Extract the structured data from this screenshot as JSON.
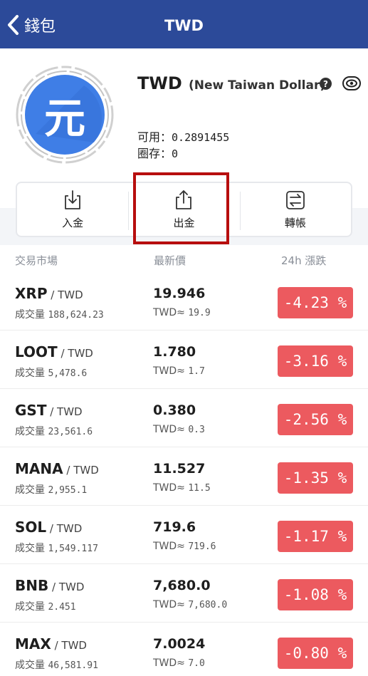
{
  "header": {
    "back_label": "錢包",
    "title": "TWD"
  },
  "currency": {
    "code": "TWD",
    "name": "(New Taiwan Dollar)",
    "icon_glyph": "元",
    "icon_color": "#3f7ee6",
    "available_label": "可用：",
    "available_value": "0.2891455",
    "locked_label": "圈存：",
    "locked_value": "0",
    "help_icon": "question-circle-icon",
    "visibility_icon": "eye-icon"
  },
  "actions": [
    {
      "label": "入金",
      "icon": "download-icon"
    },
    {
      "label": "出金",
      "icon": "upload-icon"
    },
    {
      "label": "轉帳",
      "icon": "transfer-icon"
    }
  ],
  "table": {
    "headers": [
      "交易市場",
      "最新價",
      "24h 漲跌"
    ],
    "vol_label": "成交量",
    "approx_prefix": "TWD≈",
    "rows": [
      {
        "symbol": "XRP",
        "quote": " / TWD",
        "volume": "188,624.23",
        "price": "19.946",
        "approx": "19.9",
        "change": "-4.23 %"
      },
      {
        "symbol": "LOOT",
        "quote": " / TWD",
        "volume": "5,478.6",
        "price": "1.780",
        "approx": "1.7",
        "change": "-3.16 %"
      },
      {
        "symbol": "GST",
        "quote": " / TWD",
        "volume": "23,561.6",
        "price": "0.380",
        "approx": "0.3",
        "change": "-2.56 %"
      },
      {
        "symbol": "MANA",
        "quote": " / TWD",
        "volume": "2,955.1",
        "price": "11.527",
        "approx": "11.5",
        "change": "-1.35 %"
      },
      {
        "symbol": "SOL",
        "quote": " / TWD",
        "volume": "1,549.117",
        "price": "719.6",
        "approx": "719.6",
        "change": "-1.17 %"
      },
      {
        "symbol": "BNB",
        "quote": " / TWD",
        "volume": "2.451",
        "price": "7,680.0",
        "approx": "7,680.0",
        "change": "-1.08 %"
      },
      {
        "symbol": "MAX",
        "quote": " / TWD",
        "volume": "46,581.91",
        "price": "7.0024",
        "approx": "7.0",
        "change": "-0.80 %"
      }
    ]
  },
  "colors": {
    "header_bg": "#2c4a99",
    "negative_change": "#ec5a5f",
    "highlight_box": "#b70e0e"
  }
}
